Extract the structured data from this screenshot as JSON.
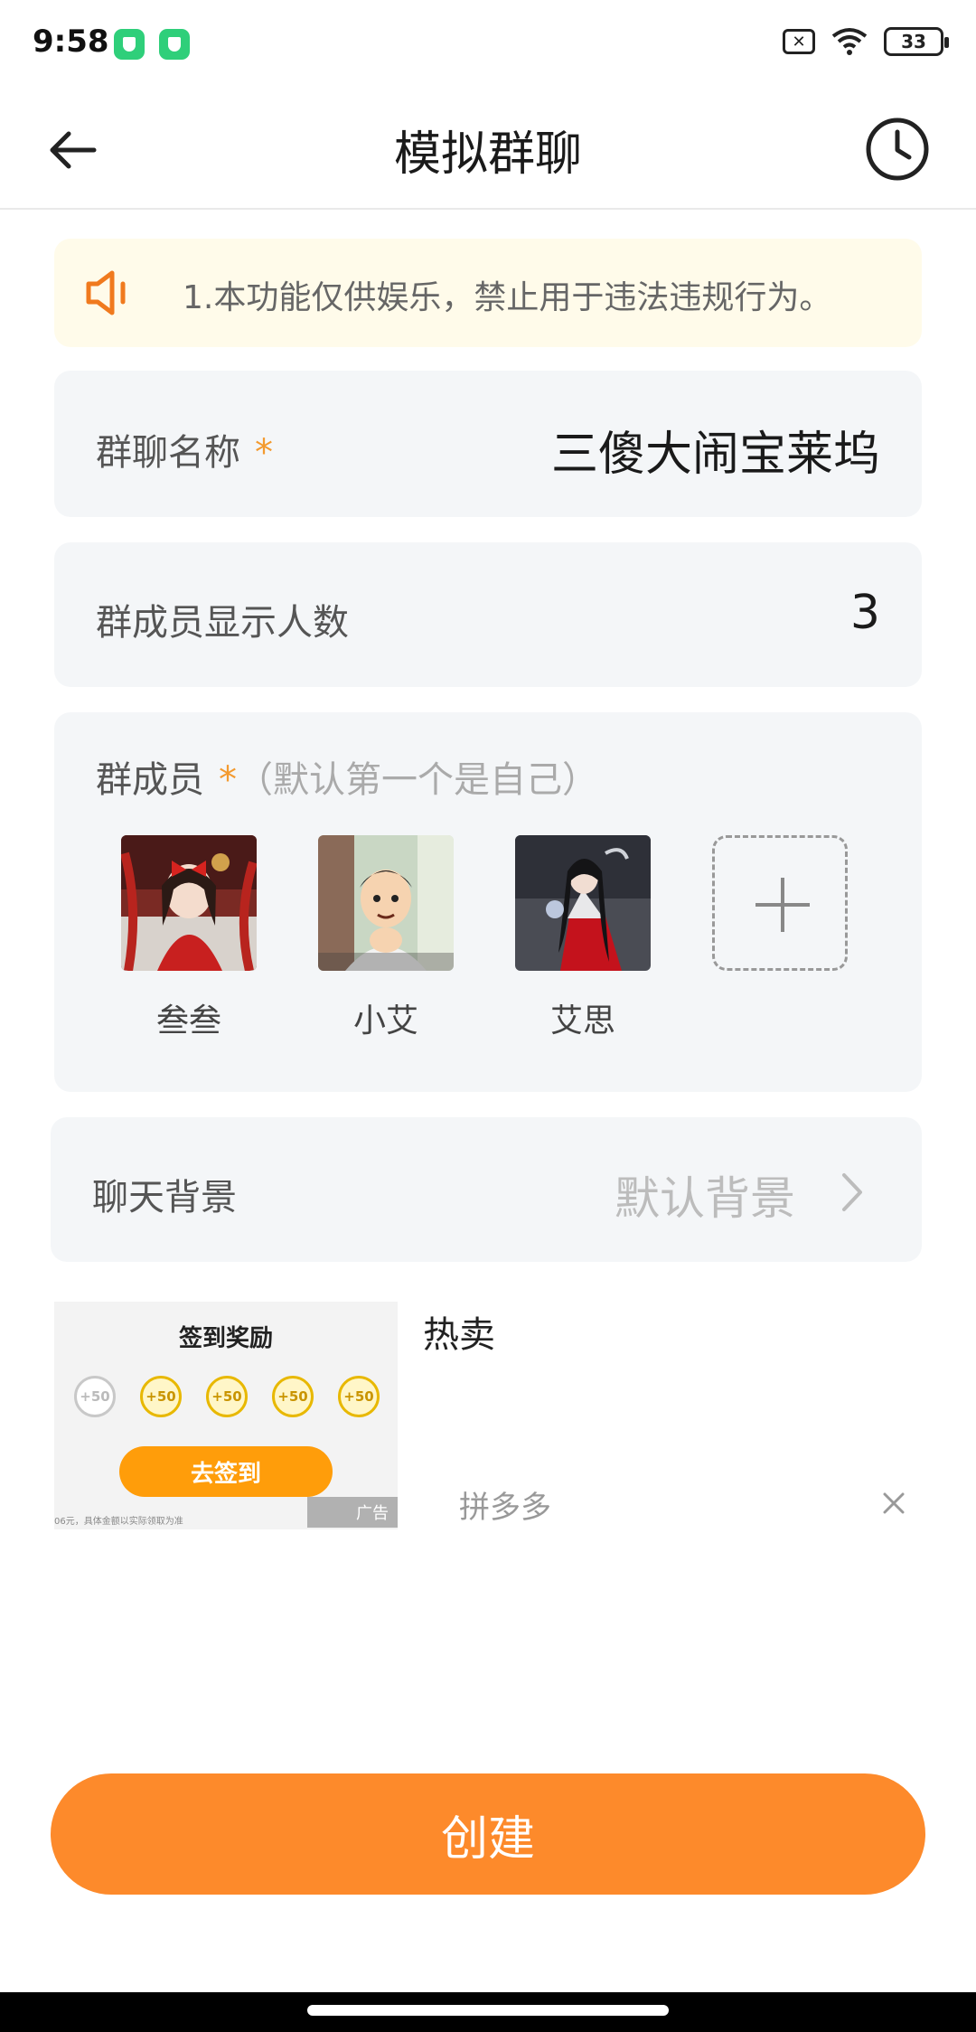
{
  "status_bar": {
    "time": "9:58",
    "battery": "33",
    "icons": [
      "app-badge-icon",
      "app-badge-icon",
      "sim-off-icon",
      "wifi-icon",
      "battery-icon"
    ]
  },
  "header": {
    "title": "模拟群聊",
    "back_icon": "arrow-left-icon",
    "history_icon": "clock-icon"
  },
  "notice": {
    "icon": "speaker-icon",
    "text": "1.本功能仅供娱乐，禁止用于违法违规行为。"
  },
  "group_name": {
    "label": "群聊名称",
    "required_mark": "*",
    "value": "三傻大闹宝莱坞"
  },
  "member_count": {
    "label": "群成员显示人数",
    "value": "3"
  },
  "members": {
    "label": "群成员",
    "required_mark": "*",
    "hint": "（默认第一个是自己）",
    "items": [
      {
        "name": "叁叁"
      },
      {
        "name": "小艾"
      },
      {
        "name": "艾思"
      }
    ],
    "add_icon": "plus-icon"
  },
  "chat_background": {
    "label": "聊天背景",
    "value": "默认背景",
    "chevron_icon": "chevron-right-icon"
  },
  "ad": {
    "image_title": "签到奖励",
    "coins": [
      "+50",
      "+50",
      "+50",
      "+50",
      "+50"
    ],
    "image_button": "去签到",
    "fine_print": "06元，具体金额以实际领取为准",
    "tag": "广告",
    "title": "热卖",
    "source": "拼多多",
    "close_icon": "close-icon"
  },
  "create_button": {
    "label": "创建"
  },
  "colors": {
    "accent": "#fd8a2b",
    "notice_bg": "#fffbea",
    "card_bg": "#f4f6f8",
    "required": "#f39a2f"
  }
}
